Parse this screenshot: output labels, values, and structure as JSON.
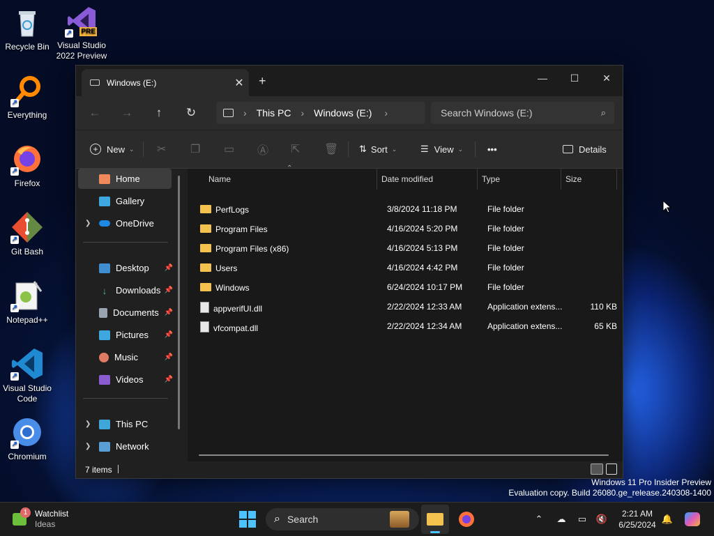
{
  "desktop_icons": [
    {
      "label": "Recycle Bin",
      "icon": "recycle-bin-icon"
    },
    {
      "label": "Visual Studio 2022 Preview",
      "badge": "PRE",
      "icon": "visual-studio-icon"
    },
    {
      "label": "Everything",
      "icon": "everything-icon"
    },
    {
      "label": "Firefox",
      "icon": "firefox-icon"
    },
    {
      "label": "Git Bash",
      "icon": "git-bash-icon"
    },
    {
      "label": "Notepad++",
      "icon": "notepad-plus-plus-icon"
    },
    {
      "label": "Visual Studio Code",
      "icon": "vscode-icon"
    },
    {
      "label": "Chromium",
      "icon": "chromium-icon"
    }
  ],
  "window": {
    "tab_title": "Windows (E:)",
    "breadcrumb": [
      "This PC",
      "Windows (E:)"
    ],
    "search_placeholder": "Search Windows (E:)",
    "toolbar": {
      "new": "New",
      "sort": "Sort",
      "view": "View",
      "more": "•••",
      "details": "Details"
    },
    "nav": {
      "home": "Home",
      "gallery": "Gallery",
      "onedrive": "OneDrive",
      "desktop": "Desktop",
      "downloads": "Downloads",
      "documents": "Documents",
      "pictures": "Pictures",
      "music": "Music",
      "videos": "Videos",
      "thispc": "This PC",
      "network": "Network"
    },
    "columns": {
      "name": "Name",
      "date": "Date modified",
      "type": "Type",
      "size": "Size"
    },
    "files": [
      {
        "name": "PerfLogs",
        "date": "3/8/2024 11:18 PM",
        "type": "File folder",
        "size": "",
        "kind": "folder"
      },
      {
        "name": "Program Files",
        "date": "4/16/2024 5:20 PM",
        "type": "File folder",
        "size": "",
        "kind": "folder"
      },
      {
        "name": "Program Files (x86)",
        "date": "4/16/2024 5:13 PM",
        "type": "File folder",
        "size": "",
        "kind": "folder"
      },
      {
        "name": "Users",
        "date": "4/16/2024 4:42 PM",
        "type": "File folder",
        "size": "",
        "kind": "folder"
      },
      {
        "name": "Windows",
        "date": "6/24/2024 10:17 PM",
        "type": "File folder",
        "size": "",
        "kind": "folder"
      },
      {
        "name": "appverifUI.dll",
        "date": "2/22/2024 12:33 AM",
        "type": "Application extens...",
        "size": "110 KB",
        "kind": "dll"
      },
      {
        "name": "vfcompat.dll",
        "date": "2/22/2024 12:34 AM",
        "type": "Application extens...",
        "size": "65 KB",
        "kind": "dll"
      }
    ],
    "status": "7 items"
  },
  "watermark": {
    "line1": "Windows 11 Pro Insider Preview",
    "line2": "Evaluation copy. Build 26080.ge_release.240308-1400"
  },
  "taskbar": {
    "widget_title": "Watchlist",
    "widget_sub": "Ideas",
    "widget_badge": "1",
    "search": "Search",
    "time": "2:21 AM",
    "date": "6/25/2024"
  }
}
